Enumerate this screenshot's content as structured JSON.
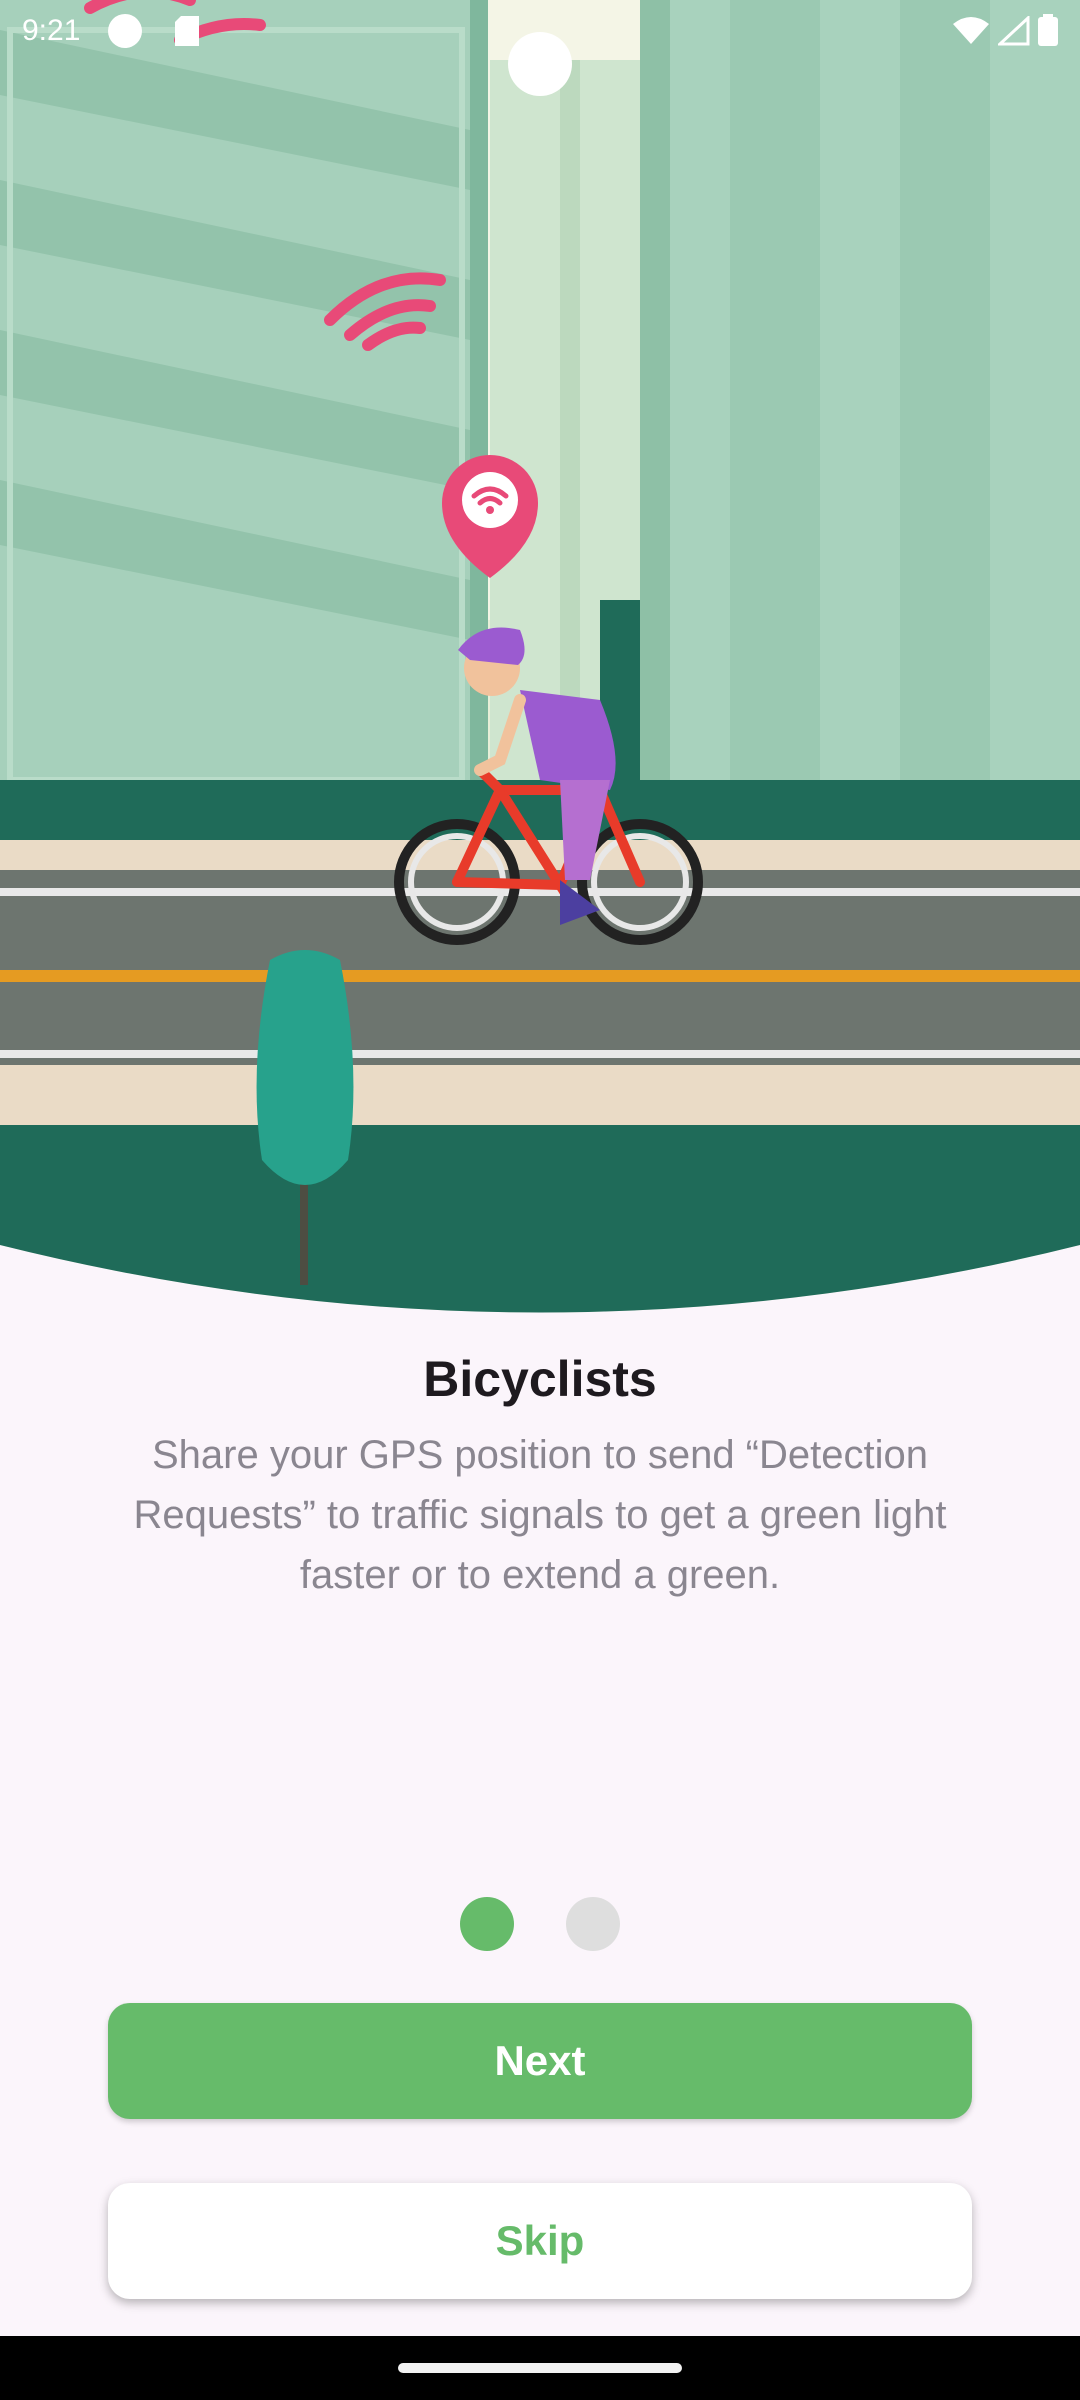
{
  "status_bar": {
    "time": "9:21"
  },
  "onboarding": {
    "title": "Bicyclists",
    "description": "Share your GPS position to send “Detection Requests” to traffic signals to get a green light faster or to extend a green.",
    "page_count": 2,
    "current_page": 1
  },
  "buttons": {
    "next_label": "Next",
    "skip_label": "Skip"
  },
  "colors": {
    "accent_green": "#66bb6a",
    "dot_active": "#66bb6a",
    "dot_inactive": "#dedede",
    "background": "#fbf5fb",
    "illustration_dark_green": "#1f6b59",
    "illustration_light_green": "#a9d1bd",
    "signal_pink": "#e84a78"
  },
  "icons": [
    "wifi-signal-icon",
    "cell-signal-icon",
    "battery-icon",
    "sd-card-icon",
    "location-pin-wifi-icon"
  ]
}
